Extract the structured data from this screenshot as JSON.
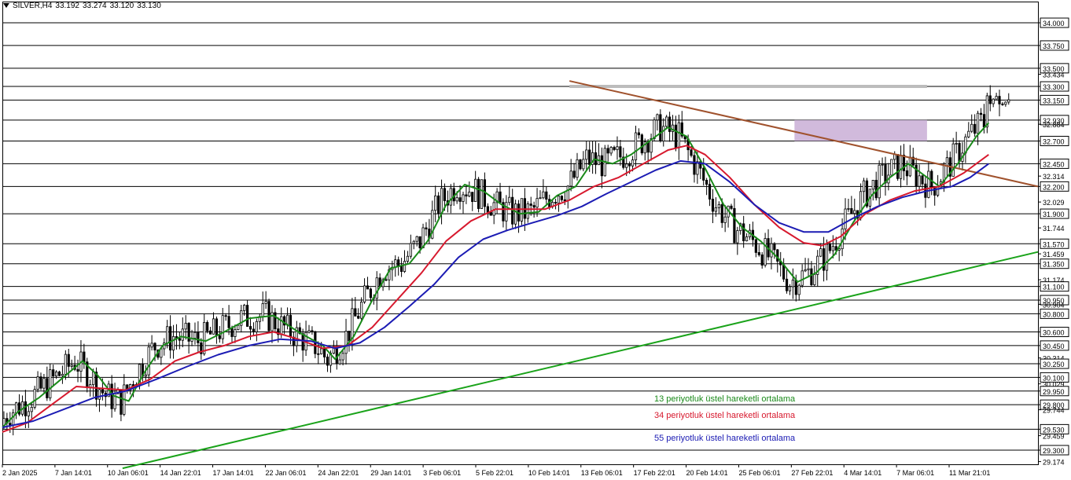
{
  "header": {
    "symbol": "SILVER,H4",
    "open": "33.192",
    "high": "33.274",
    "low": "33.120",
    "close": "33.130"
  },
  "legend": {
    "ema13": "13 periyotluk üstel hareketli ortalama",
    "ema34": "34 periyotluk üstel hareketli ortalama",
    "ema55": "55 periyotluk üstel hareketli ortalama"
  },
  "colors": {
    "ema13": "#1a8a1a",
    "ema34": "#d7192e",
    "ema55": "#1c1cb4",
    "resistance_trendline": "#a0522d",
    "support_trendline": "#1aa31a",
    "zone": "#c9aed6",
    "top_line": "#bcbcbc",
    "candles": "#000000"
  },
  "chart_data": {
    "type": "line",
    "title": "",
    "symbol": "SILVER",
    "timeframe": "H4",
    "ylim": [
      29.1,
      34.3
    ],
    "grid": true,
    "y_ticks": [
      "34.000",
      "33.750",
      "33.500",
      "33.434",
      "33.300",
      "33.150",
      "32.930",
      "32.884",
      "32.700",
      "32.450",
      "32.314",
      "32.200",
      "32.029",
      "31.900",
      "31.744",
      "31.570",
      "31.459",
      "31.350",
      "31.174",
      "31.100",
      "30.950",
      "30.904",
      "30.800",
      "30.600",
      "30.450",
      "30.314",
      "30.250",
      "30.100",
      "30.029",
      "29.950",
      "29.800",
      "29.744",
      "29.530",
      "29.459",
      "29.300",
      "29.174"
    ],
    "horizontal_levels": [
      34.0,
      33.75,
      33.5,
      33.3,
      33.15,
      32.93,
      32.7,
      32.45,
      32.2,
      31.9,
      31.57,
      31.35,
      31.1,
      30.95,
      30.8,
      30.6,
      30.45,
      30.25,
      30.1,
      29.95,
      29.8,
      29.53,
      29.3
    ],
    "x_labels": [
      "2 Jan 2025",
      "7 Jan 14:01",
      "10 Jan 06:01",
      "14 Jan 22:01",
      "17 Jan 14:01",
      "22 Jan 06:01",
      "24 Jan 22:01",
      "29 Jan 14:01",
      "3 Feb 06:01",
      "5 Feb 22:01",
      "10 Feb 14:01",
      "13 Feb 06:01",
      "17 Feb 22:01",
      "20 Feb 14:01",
      "25 Feb 06:01",
      "27 Feb 22:01",
      "4 Mar 14:01",
      "7 Mar 06:01",
      "11 Mar 21:01"
    ],
    "series": [
      {
        "name": "13 periyotluk üstel hareketli ortalama",
        "values": [
          [
            0,
            29.55
          ],
          [
            5,
            29.72
          ],
          [
            12,
            29.88
          ],
          [
            18,
            30.05
          ],
          [
            26,
            30.28
          ],
          [
            31,
            30.12
          ],
          [
            36,
            29.9
          ],
          [
            41,
            29.84
          ],
          [
            46,
            30.15
          ],
          [
            52,
            30.45
          ],
          [
            58,
            30.55
          ],
          [
            66,
            30.5
          ],
          [
            72,
            30.6
          ],
          [
            80,
            30.75
          ],
          [
            88,
            30.78
          ],
          [
            96,
            30.6
          ],
          [
            104,
            30.45
          ],
          [
            108,
            30.3
          ],
          [
            114,
            30.55
          ],
          [
            120,
            30.95
          ],
          [
            126,
            31.3
          ],
          [
            132,
            31.35
          ],
          [
            138,
            31.6
          ],
          [
            144,
            32.0
          ],
          [
            150,
            32.22
          ],
          [
            156,
            32.15
          ],
          [
            162,
            32.0
          ],
          [
            168,
            31.9
          ],
          [
            174,
            31.92
          ],
          [
            180,
            32.1
          ],
          [
            186,
            32.2
          ],
          [
            192,
            32.5
          ],
          [
            198,
            32.45
          ],
          [
            204,
            32.55
          ],
          [
            210,
            32.7
          ],
          [
            216,
            32.85
          ],
          [
            222,
            32.75
          ],
          [
            228,
            32.4
          ],
          [
            234,
            32.0
          ],
          [
            240,
            31.75
          ],
          [
            246,
            31.6
          ],
          [
            252,
            31.4
          ],
          [
            258,
            31.15
          ],
          [
            264,
            31.25
          ],
          [
            270,
            31.45
          ],
          [
            276,
            31.8
          ],
          [
            282,
            32.1
          ],
          [
            288,
            32.3
          ],
          [
            294,
            32.45
          ],
          [
            298,
            32.35
          ],
          [
            304,
            32.2
          ],
          [
            310,
            32.45
          ],
          [
            316,
            32.75
          ],
          [
            320,
            32.9
          ]
        ]
      },
      {
        "name": "34 periyotluk üstel hareketli ortalama",
        "values": [
          [
            0,
            29.5
          ],
          [
            8,
            29.6
          ],
          [
            16,
            29.8
          ],
          [
            24,
            30.0
          ],
          [
            32,
            29.98
          ],
          [
            40,
            29.96
          ],
          [
            48,
            30.08
          ],
          [
            56,
            30.28
          ],
          [
            64,
            30.38
          ],
          [
            72,
            30.45
          ],
          [
            80,
            30.55
          ],
          [
            88,
            30.6
          ],
          [
            96,
            30.52
          ],
          [
            104,
            30.42
          ],
          [
            112,
            30.45
          ],
          [
            120,
            30.65
          ],
          [
            128,
            30.95
          ],
          [
            136,
            31.25
          ],
          [
            144,
            31.6
          ],
          [
            152,
            31.82
          ],
          [
            160,
            31.95
          ],
          [
            168,
            31.95
          ],
          [
            176,
            31.95
          ],
          [
            184,
            32.05
          ],
          [
            192,
            32.2
          ],
          [
            200,
            32.3
          ],
          [
            208,
            32.45
          ],
          [
            216,
            32.6
          ],
          [
            222,
            32.65
          ],
          [
            228,
            32.55
          ],
          [
            236,
            32.3
          ],
          [
            244,
            32.0
          ],
          [
            252,
            31.75
          ],
          [
            260,
            31.58
          ],
          [
            266,
            31.55
          ],
          [
            272,
            31.65
          ],
          [
            280,
            31.9
          ],
          [
            288,
            32.05
          ],
          [
            296,
            32.15
          ],
          [
            304,
            32.2
          ],
          [
            312,
            32.35
          ],
          [
            320,
            32.55
          ]
        ]
      },
      {
        "name": "55 periyotluk üstel hareketli ortalama",
        "values": [
          [
            0,
            29.55
          ],
          [
            10,
            29.62
          ],
          [
            20,
            29.75
          ],
          [
            30,
            29.88
          ],
          [
            40,
            29.95
          ],
          [
            50,
            30.08
          ],
          [
            60,
            30.22
          ],
          [
            70,
            30.35
          ],
          [
            80,
            30.45
          ],
          [
            90,
            30.52
          ],
          [
            100,
            30.5
          ],
          [
            108,
            30.42
          ],
          [
            116,
            30.48
          ],
          [
            124,
            30.65
          ],
          [
            132,
            30.88
          ],
          [
            140,
            31.12
          ],
          [
            148,
            31.42
          ],
          [
            156,
            31.62
          ],
          [
            164,
            31.72
          ],
          [
            172,
            31.8
          ],
          [
            180,
            31.88
          ],
          [
            188,
            31.98
          ],
          [
            196,
            32.12
          ],
          [
            204,
            32.25
          ],
          [
            212,
            32.38
          ],
          [
            220,
            32.48
          ],
          [
            228,
            32.45
          ],
          [
            236,
            32.25
          ],
          [
            244,
            32.0
          ],
          [
            252,
            31.8
          ],
          [
            260,
            31.7
          ],
          [
            268,
            31.7
          ],
          [
            276,
            31.85
          ],
          [
            284,
            31.98
          ],
          [
            292,
            32.08
          ],
          [
            300,
            32.15
          ],
          [
            308,
            32.2
          ],
          [
            314,
            32.3
          ],
          [
            320,
            32.45
          ]
        ]
      },
      {
        "name": "",
        "values": [
          [
            39,
            29.1
          ],
          [
            336,
            31.48
          ]
        ]
      },
      {
        "name": "",
        "values": [
          [
            184,
            33.36
          ],
          [
            336,
            32.2
          ]
        ]
      }
    ],
    "zone": {
      "x": [
        257,
        300
      ],
      "y": [
        32.7,
        32.93
      ]
    },
    "top_level": {
      "x": [
        184,
        300
      ],
      "y": 33.3
    }
  }
}
